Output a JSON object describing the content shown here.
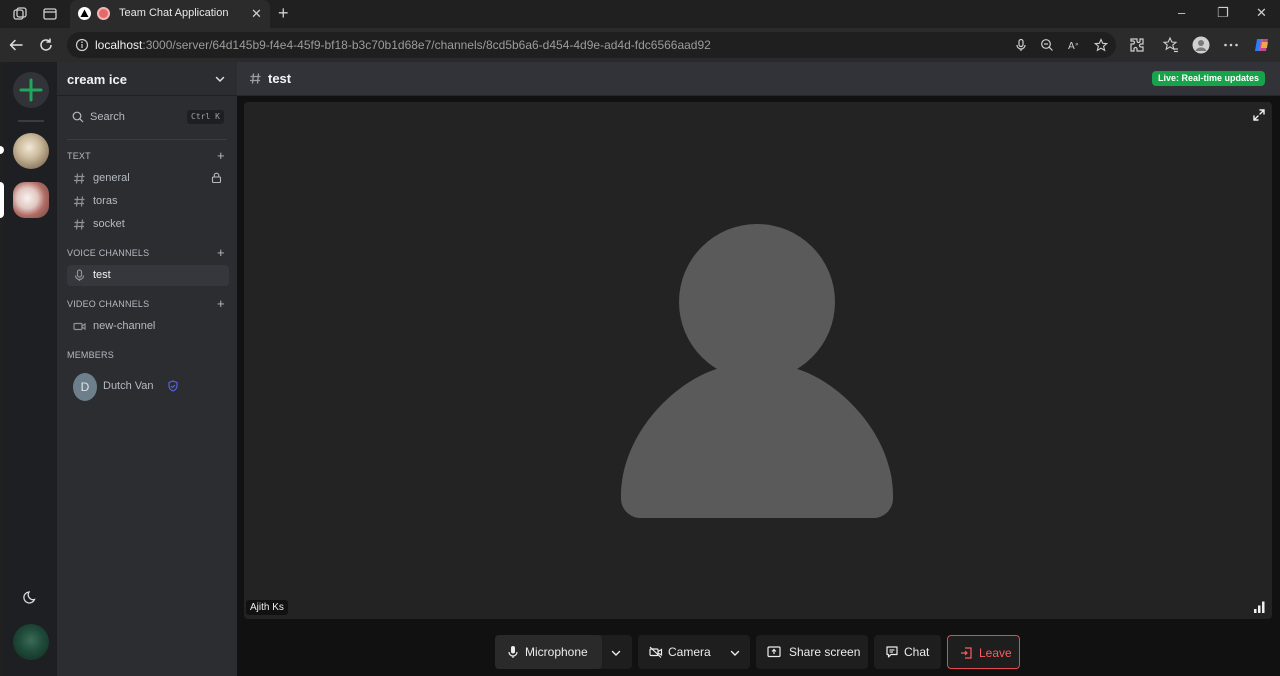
{
  "browser": {
    "tab_title": "Team Chat Application",
    "url_host": "localhost",
    "url_rest": ":3000/server/64d145b9-f4e4-45f9-bf18-b3c70b1d68e7/channels/8cd5b6a6-d454-4d9e-ad4d-fdc6566aad92"
  },
  "sidebar": {
    "server_name": "cream ice",
    "search_label": "Search",
    "search_shortcut": "Ctrl K",
    "text_section": "TEXT",
    "text_channels": [
      "general",
      "toras",
      "socket"
    ],
    "voice_section": "VOICE CHANNELS",
    "voice_channels": [
      "test"
    ],
    "video_section": "VIDEO CHANNELS",
    "video_channels": [
      "new-channel"
    ],
    "members_section": "MEMBERS",
    "members": [
      {
        "initial": "D",
        "name": "Dutch Van"
      }
    ]
  },
  "main": {
    "channel_name": "test",
    "live_badge": "Live: Real-time updates",
    "participant_name": "Ajith Ks"
  },
  "controls": {
    "microphone": "Microphone",
    "camera": "Camera",
    "share_screen": "Share screen",
    "chat": "Chat",
    "leave": "Leave"
  },
  "colors": {
    "accent_green": "#16a34a",
    "leave_red": "#e5484d",
    "add_server_green": "#23a55a"
  }
}
